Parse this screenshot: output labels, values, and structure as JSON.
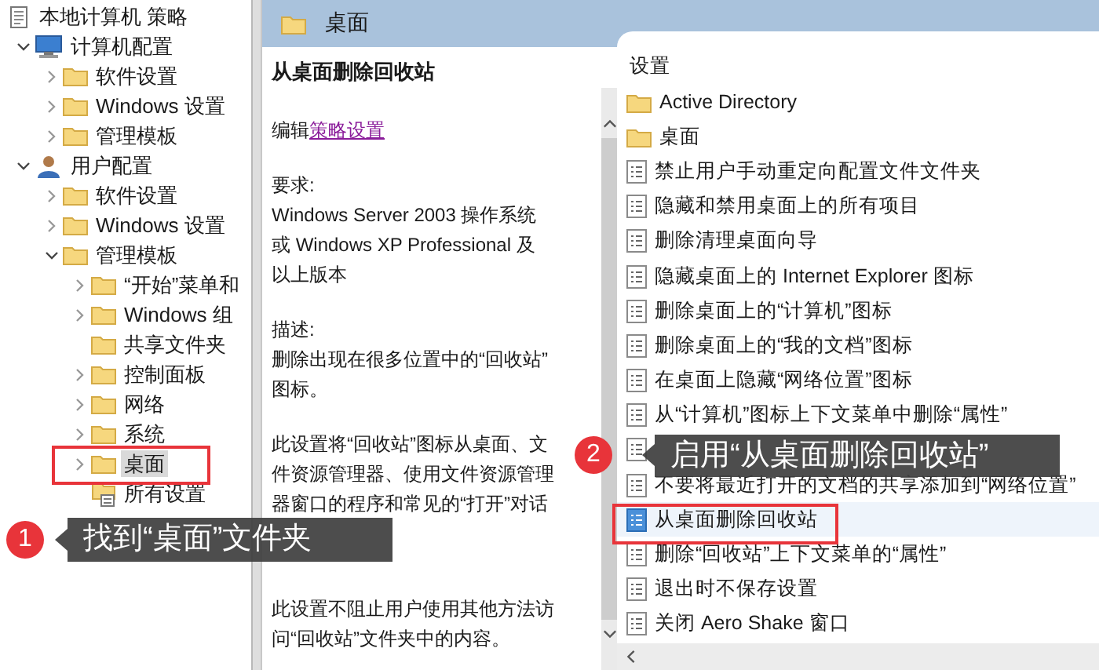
{
  "tree": {
    "items": [
      {
        "label": "本地计算机 策略",
        "kind": "policy",
        "selected": false,
        "children": [
          {
            "label": "计算机配置",
            "kind": "computer",
            "expandable": true,
            "expanded": true,
            "selected": false,
            "children": [
              {
                "label": "软件设置",
                "kind": "folder",
                "expandable": true,
                "expanded": false,
                "selected": false
              },
              {
                "label": "Windows 设置",
                "kind": "folder",
                "expandable": true,
                "expanded": false,
                "selected": false
              },
              {
                "label": "管理模板",
                "kind": "folder",
                "expandable": true,
                "expanded": false,
                "selected": false
              }
            ]
          },
          {
            "label": "用户配置",
            "kind": "user",
            "expandable": true,
            "expanded": true,
            "selected": false,
            "children": [
              {
                "label": "软件设置",
                "kind": "folder",
                "expandable": true,
                "expanded": false,
                "selected": false
              },
              {
                "label": "Windows 设置",
                "kind": "folder",
                "expandable": true,
                "expanded": false,
                "selected": false
              },
              {
                "label": "管理模板",
                "kind": "folder",
                "expandable": true,
                "expanded": true,
                "selected": false,
                "children": [
                  {
                    "label": "“开始”菜单和",
                    "kind": "folder",
                    "expandable": true,
                    "expanded": false,
                    "selected": false
                  },
                  {
                    "label": "Windows 组",
                    "kind": "folder",
                    "expandable": true,
                    "expanded": false,
                    "selected": false
                  },
                  {
                    "label": "共享文件夹",
                    "kind": "folder",
                    "expandable": false,
                    "selected": false
                  },
                  {
                    "label": "控制面板",
                    "kind": "folder",
                    "expandable": true,
                    "expanded": false,
                    "selected": false
                  },
                  {
                    "label": "网络",
                    "kind": "folder",
                    "expandable": true,
                    "expanded": false,
                    "selected": false
                  },
                  {
                    "label": "系统",
                    "kind": "folder",
                    "expandable": true,
                    "expanded": false,
                    "selected": false
                  },
                  {
                    "label": "桌面",
                    "kind": "folder",
                    "expandable": true,
                    "expanded": false,
                    "selected": true
                  },
                  {
                    "label": "所有设置",
                    "kind": "all-settings",
                    "expandable": false,
                    "selected": false
                  }
                ]
              }
            ]
          }
        ]
      }
    ]
  },
  "header": {
    "title": "桌面"
  },
  "detail": {
    "title": "从桌面删除回收站",
    "edit_prefix": "编辑",
    "edit_link": "策略设置",
    "paragraphs": [
      [
        "要求:",
        "Windows Server 2003 操作系统",
        "或 Windows XP Professional 及",
        "以上版本"
      ],
      [
        "描述:",
        "删除出现在很多位置中的“回收站”",
        "图标。"
      ],
      [
        "此设置将“回收站”图标从桌面、文",
        "件资源管理器、使用文件资源管理",
        "器窗口的程序和常见的“打开”对话"
      ],
      [
        "此设置不阻止用户使用其他方法访",
        "问“回收站”文件夹中的内容。"
      ]
    ]
  },
  "settings": {
    "column": "设置",
    "items": [
      {
        "label": "Active Directory",
        "kind": "folder",
        "selected": false
      },
      {
        "label": "桌面",
        "kind": "folder",
        "selected": false
      },
      {
        "label": "禁止用户手动重定向配置文件文件夹",
        "kind": "setting",
        "selected": false
      },
      {
        "label": "隐藏和禁用桌面上的所有项目",
        "kind": "setting",
        "selected": false
      },
      {
        "label": "删除清理桌面向导",
        "kind": "setting",
        "selected": false
      },
      {
        "label": "隐藏桌面上的 Internet Explorer 图标",
        "kind": "setting",
        "selected": false
      },
      {
        "label": "删除桌面上的“计算机”图标",
        "kind": "setting",
        "selected": false
      },
      {
        "label": "删除桌面上的“我的文档”图标",
        "kind": "setting",
        "selected": false
      },
      {
        "label": "在桌面上隐藏“网络位置”图标",
        "kind": "setting",
        "selected": false
      },
      {
        "label": "从“计算机”图标上下文菜单中删除“属性”",
        "kind": "setting",
        "selected": false
      },
      {
        "kind": "setting",
        "selected": false
      },
      {
        "label": "不要将最近打开的文档的共享添加到“网络位置”",
        "kind": "setting",
        "selected": false
      },
      {
        "label": "从桌面删除回收站",
        "kind": "setting",
        "selected": true
      },
      {
        "label": "删除“回收站”上下文菜单的“属性”",
        "kind": "setting",
        "selected": false
      },
      {
        "label": "退出时不保存设置",
        "kind": "setting",
        "selected": false
      },
      {
        "label": "关闭 Aero Shake 窗口",
        "kind": "setting",
        "selected": false
      }
    ]
  },
  "annotations": [
    {
      "number": "1",
      "text": "找到“桌面”文件夹"
    },
    {
      "number": "2",
      "text": "启用“从桌面删除回收站”"
    }
  ]
}
